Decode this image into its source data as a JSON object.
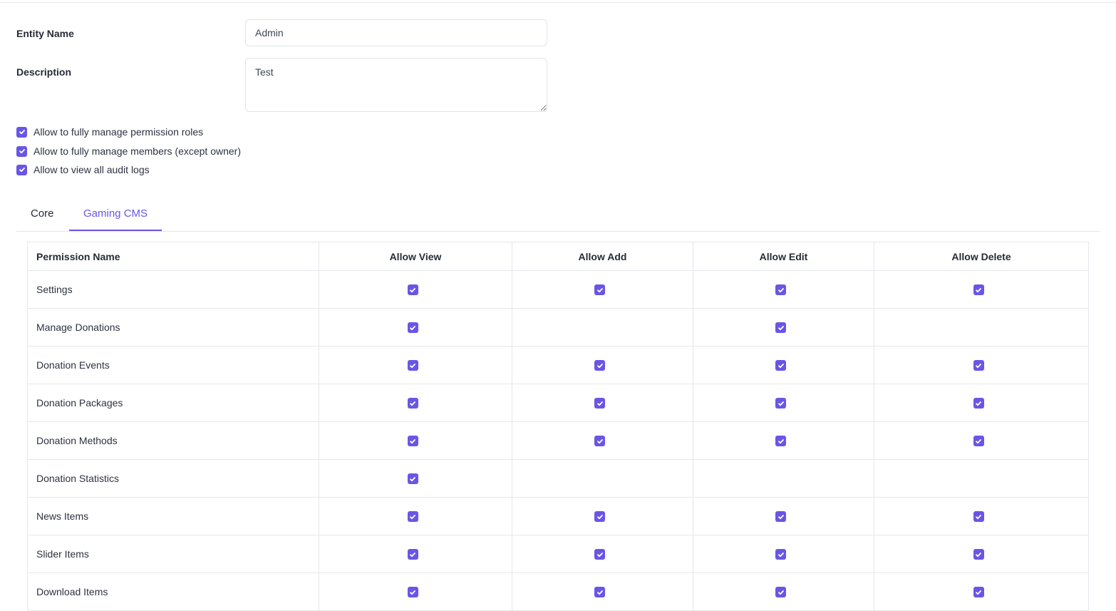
{
  "form": {
    "entity_name_label": "Entity Name",
    "entity_name_value": "Admin",
    "description_label": "Description",
    "description_value": "Test"
  },
  "options": [
    {
      "label": "Allow to fully manage permission roles",
      "checked": true
    },
    {
      "label": "Allow to fully manage members (except owner)",
      "checked": true
    },
    {
      "label": "Allow to view all audit logs",
      "checked": true
    }
  ],
  "tabs": [
    {
      "label": "Core",
      "active": false
    },
    {
      "label": "Gaming CMS",
      "active": true
    }
  ],
  "table": {
    "headers": [
      "Permission Name",
      "Allow View",
      "Allow Add",
      "Allow Edit",
      "Allow Delete"
    ],
    "rows": [
      {
        "name": "Settings",
        "view": true,
        "add": true,
        "edit": true,
        "delete": true
      },
      {
        "name": "Manage Donations",
        "view": true,
        "add": false,
        "edit": true,
        "delete": false
      },
      {
        "name": "Donation Events",
        "view": true,
        "add": true,
        "edit": true,
        "delete": true
      },
      {
        "name": "Donation Packages",
        "view": true,
        "add": true,
        "edit": true,
        "delete": true
      },
      {
        "name": "Donation Methods",
        "view": true,
        "add": true,
        "edit": true,
        "delete": true
      },
      {
        "name": "Donation Statistics",
        "view": true,
        "add": false,
        "edit": false,
        "delete": false
      },
      {
        "name": "News Items",
        "view": true,
        "add": true,
        "edit": true,
        "delete": true
      },
      {
        "name": "Slider Items",
        "view": true,
        "add": true,
        "edit": true,
        "delete": true
      },
      {
        "name": "Download Items",
        "view": true,
        "add": true,
        "edit": true,
        "delete": true
      }
    ]
  },
  "colors": {
    "accent": "#6956e6",
    "border": "#e6e7ec",
    "text": "#262b36"
  },
  "icons": {
    "checkbox_checked": "checkmark-icon"
  }
}
